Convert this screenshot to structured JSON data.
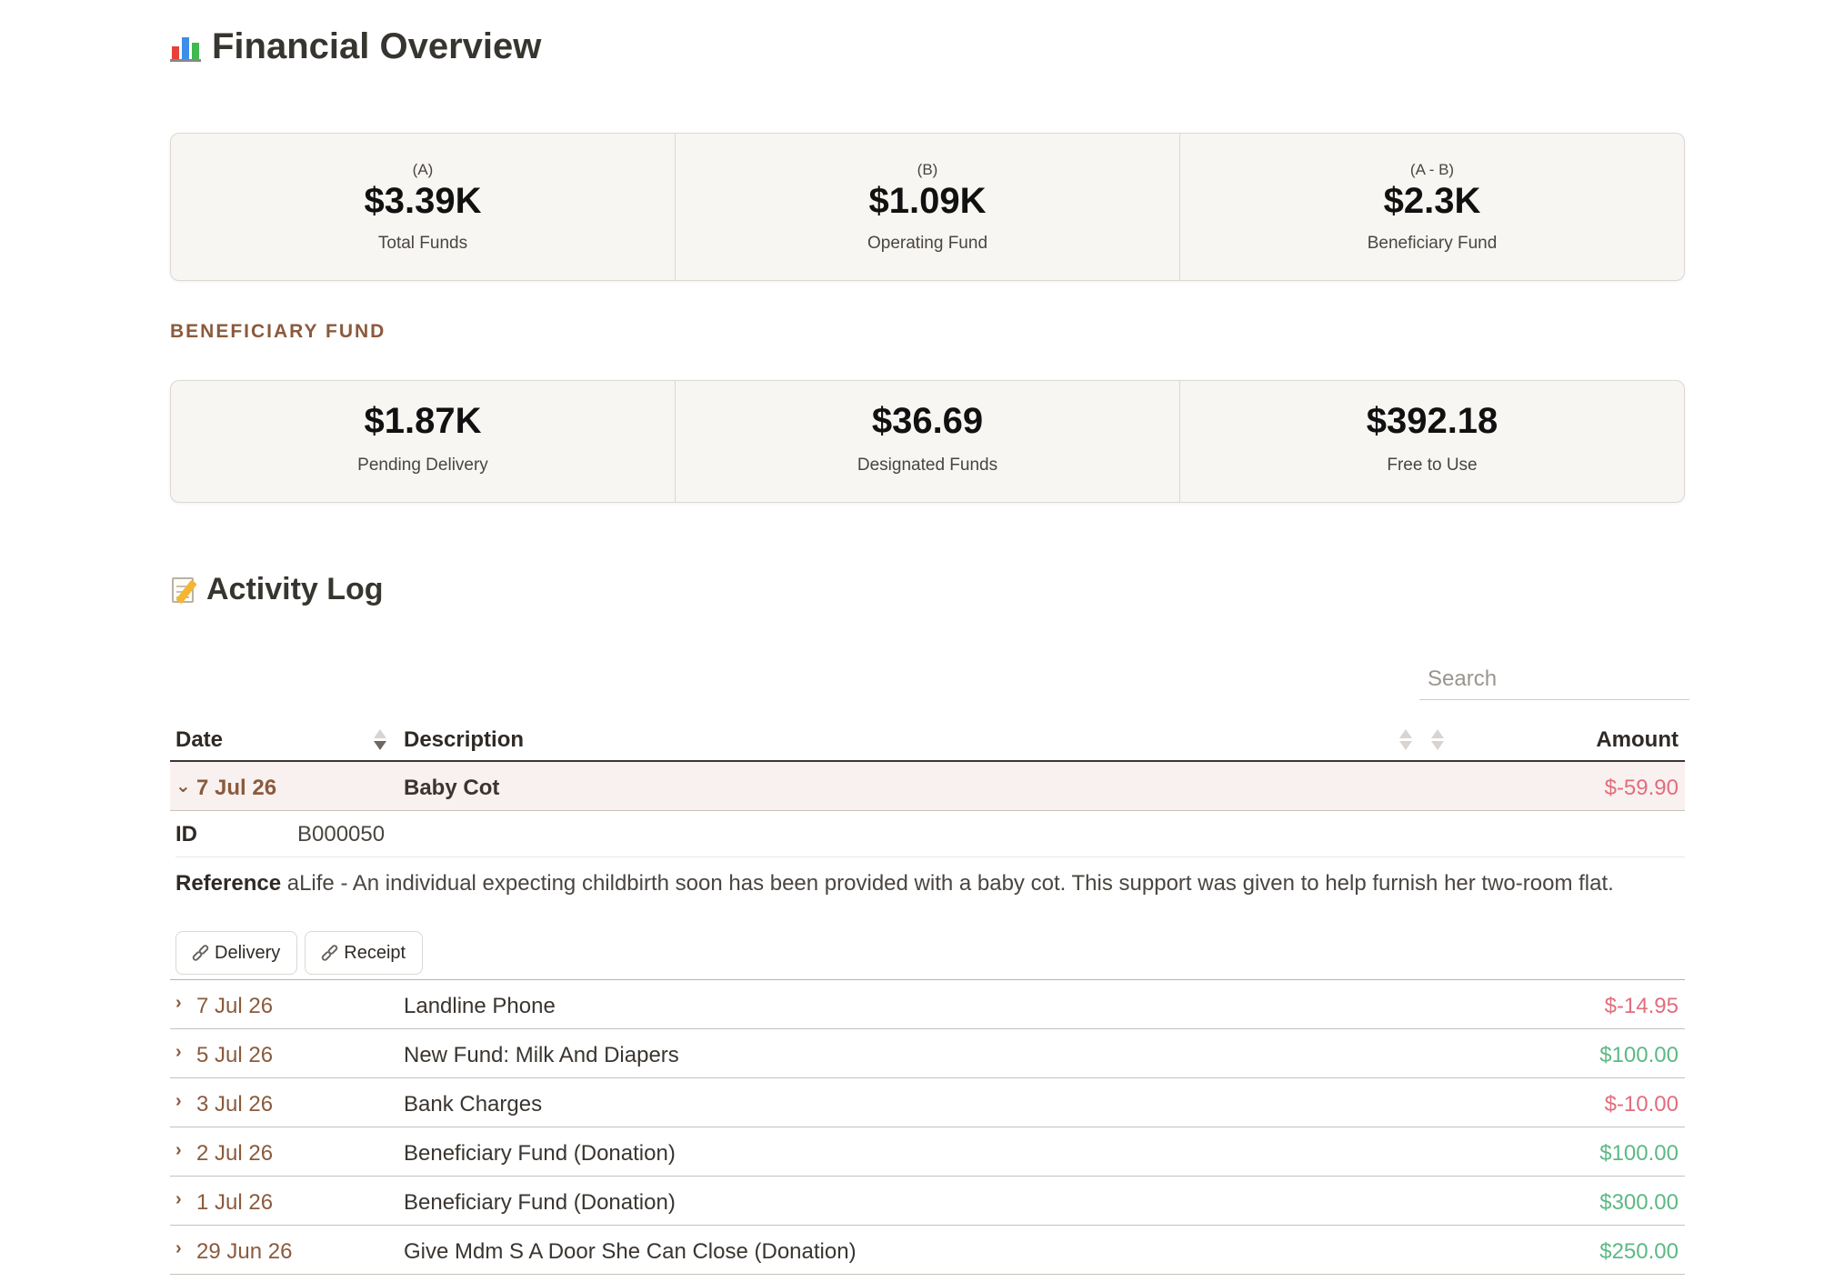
{
  "header": {
    "title": "Financial Overview",
    "icon": "bar-chart-icon"
  },
  "overview": [
    {
      "caption": "(A)",
      "value": "$3.39K",
      "label": "Total Funds"
    },
    {
      "caption": "(B)",
      "value": "$1.09K",
      "label": "Operating Fund"
    },
    {
      "caption": "(A - B)",
      "value": "$2.3K",
      "label": "Beneficiary Fund"
    }
  ],
  "beneficiary": {
    "section_label": "BENEFICIARY FUND",
    "stats": [
      {
        "value": "$1.87K",
        "label": "Pending Delivery"
      },
      {
        "value": "$36.69",
        "label": "Designated Funds"
      },
      {
        "value": "$392.18",
        "label": "Free to Use"
      }
    ]
  },
  "activity": {
    "title": "Activity Log",
    "icon": "memo-icon",
    "search_placeholder": "Search",
    "columns": {
      "date": "Date",
      "description": "Description",
      "amount": "Amount"
    },
    "expanded": {
      "date": "7 Jul 26",
      "description": "Baby Cot",
      "amount": "$-59.90",
      "id_label": "ID",
      "id_value": "B000050",
      "reference_label": "Reference",
      "reference_value": "aLife - An individual expecting childbirth soon has been provided with a baby cot. This support was given to help furnish her two-room flat.",
      "link_delivery": "Delivery",
      "link_receipt": "Receipt"
    },
    "rows": [
      {
        "date": "7 Jul 26",
        "description": "Landline Phone",
        "amount": "$-14.95",
        "sign": "neg"
      },
      {
        "date": "5 Jul 26",
        "description": "New Fund: Milk And Diapers",
        "amount": "$100.00",
        "sign": "pos"
      },
      {
        "date": "3 Jul 26",
        "description": "Bank Charges",
        "amount": "$-10.00",
        "sign": "neg"
      },
      {
        "date": "2 Jul 26",
        "description": "Beneficiary Fund (Donation)",
        "amount": "$100.00",
        "sign": "pos"
      },
      {
        "date": "1 Jul 26",
        "description": "Beneficiary Fund (Donation)",
        "amount": "$300.00",
        "sign": "pos"
      },
      {
        "date": "29 Jun 26",
        "description": "Give Mdm S A Door She Can Close (Donation)",
        "amount": "$250.00",
        "sign": "pos"
      }
    ]
  },
  "colors": {
    "accent": "#8b5a3c",
    "negative": "#e26d7d",
    "positive": "#5cb985"
  }
}
